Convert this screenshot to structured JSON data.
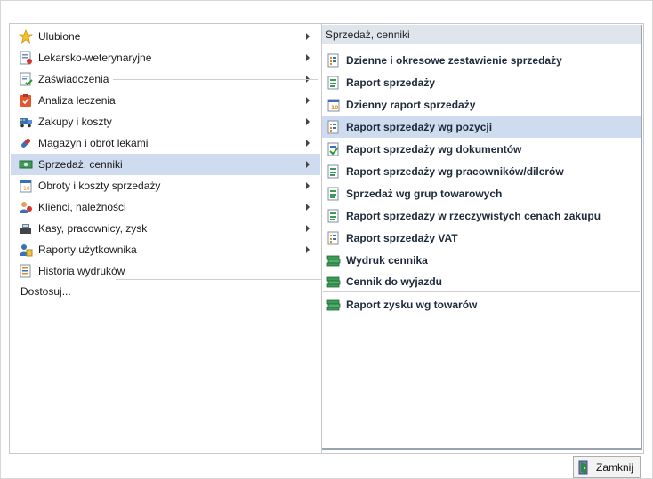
{
  "left_menu": {
    "items": [
      {
        "label": "Ulubione",
        "icon": "star-icon",
        "has_submenu": true
      },
      {
        "label": "Lekarsko-weterynaryjne",
        "icon": "vet-document-icon",
        "has_submenu": true
      },
      {
        "label": "Zaświadczenia",
        "icon": "certificate-icon",
        "has_submenu": true
      },
      {
        "label": "Analiza leczenia",
        "icon": "clipboard-icon",
        "has_submenu": true
      },
      {
        "label": "Zakupy i koszty",
        "icon": "truck-icon",
        "has_submenu": true
      },
      {
        "label": "Magazyn i obrót lekami",
        "icon": "pill-icon",
        "has_submenu": true
      },
      {
        "label": "Sprzedaż, cenniki",
        "icon": "money-icon",
        "has_submenu": true,
        "selected": true
      },
      {
        "label": "Obroty i koszty sprzedaży",
        "icon": "calendar-report-icon",
        "has_submenu": true
      },
      {
        "label": "Klienci, należności",
        "icon": "clients-icon",
        "has_submenu": true
      },
      {
        "label": "Kasy, pracownicy, zysk",
        "icon": "cash-register-icon",
        "has_submenu": true
      },
      {
        "label": "Raporty użytkownika",
        "icon": "user-report-icon",
        "has_submenu": true
      },
      {
        "label": "Historia wydruków",
        "icon": "print-history-icon",
        "has_submenu": false
      }
    ],
    "customize_label": "Dostosuj..."
  },
  "right_panel": {
    "header": "Sprzedaż, cenniki",
    "items": [
      {
        "label": "Dzienne i okresowe zestawienie sprzedaży",
        "icon": "report-list-icon"
      },
      {
        "label": "Raport sprzedaży",
        "icon": "report-green-icon"
      },
      {
        "label": "Dzienny raport sprzedaży",
        "icon": "calendar-report-icon"
      },
      {
        "label": "Raport sprzedaży wg pozycji",
        "icon": "report-list-icon",
        "hover": true
      },
      {
        "label": "Raport sprzedaży wg dokumentów",
        "icon": "report-check-icon"
      },
      {
        "label": "Raport sprzedaży wg pracowników/dilerów",
        "icon": "report-green-icon"
      },
      {
        "label": "Sprzedaż wg grup towarowych",
        "icon": "report-green-icon"
      },
      {
        "label": "Raport sprzedaży w rzeczywistych cenach zakupu",
        "icon": "report-green-icon"
      },
      {
        "label": "Raport sprzedaży VAT",
        "icon": "report-list-icon"
      },
      {
        "label": "Wydruk cennika",
        "icon": "money-stack-icon"
      },
      {
        "label": "Cennik do wyjazdu",
        "icon": "money-stack-icon"
      },
      {
        "label": "Raport zysku wg towarów",
        "icon": "money-stack-icon"
      }
    ]
  },
  "footer": {
    "close_label": "Zamknij"
  },
  "colors": {
    "selected_bg": "#cfdcef",
    "header_bg": "#dfe5ec",
    "accent_blue": "#1d2a3a"
  }
}
